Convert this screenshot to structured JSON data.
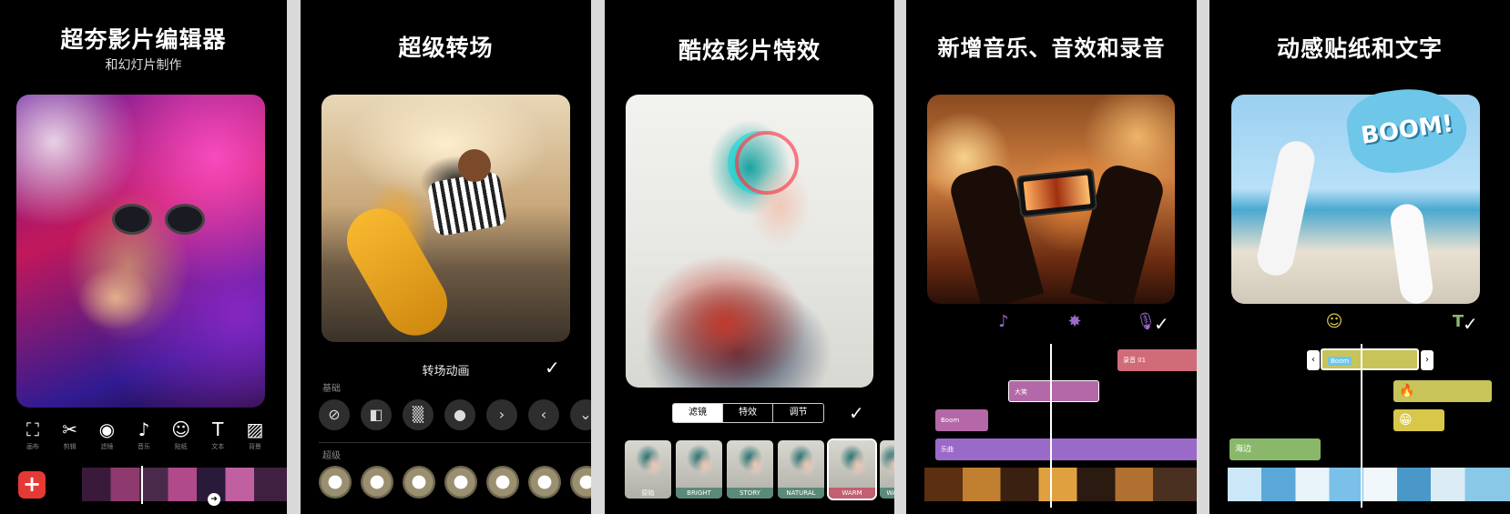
{
  "panels": {
    "p1": {
      "title": "超夯影片编辑器",
      "subtitle": "和幻灯片制作",
      "tools": [
        {
          "icon": "⛶",
          "label": "画布"
        },
        {
          "icon": "✂",
          "label": "剪辑"
        },
        {
          "icon": "◉",
          "label": "滤镜"
        },
        {
          "icon": "♪",
          "label": "音乐"
        },
        {
          "icon": "☺",
          "label": "贴纸"
        },
        {
          "icon": "T",
          "label": "文本"
        },
        {
          "icon": "▨",
          "label": "背景"
        }
      ],
      "add_symbol": "+",
      "knob_symbol": "➜"
    },
    "p2": {
      "title": "超级转场",
      "section_title": "转场动画",
      "group_basic": "基础",
      "group_super": "超级",
      "basic_icons": [
        "⊘",
        "◧",
        "▒",
        "●",
        "›",
        "‹",
        "⌄"
      ],
      "check": "✓"
    },
    "p3": {
      "title": "酷炫影片特效",
      "tabs": [
        "滤镜",
        "特效",
        "调节"
      ],
      "active_tab": "滤镜",
      "check": "✓",
      "filters": [
        "原始",
        "BRIGHT",
        "STORY",
        "NATURAL",
        "WARM",
        "WA"
      ]
    },
    "p4": {
      "title": "新增音乐、音效和录音",
      "icons": [
        "♪",
        "✸",
        "🎙"
      ],
      "check": "✓",
      "clips": {
        "recording": "录音 01",
        "laugh": "大笑",
        "boom": "Boom",
        "music": "乐曲"
      }
    },
    "p5": {
      "title": "动感贴纸和文字",
      "sticker_text": "BOOM!",
      "icons": [
        "☺",
        "T"
      ],
      "check": "✓",
      "mini_sticker": "Boom",
      "emoji_fire": "🔥",
      "emoji_grin": "😁",
      "text_clip": "海边",
      "handle_left": "‹",
      "handle_right": "›"
    }
  },
  "colors": {
    "accent_red": "#e53935",
    "clip_pink": "#d06c78",
    "clip_magenta": "#b468a8",
    "clip_purple": "#9a6ac8",
    "clip_yellow": "#c8c45a",
    "clip_green": "#8ab86a",
    "icon_purple": "#9a6ac8",
    "icon_green": "#8ab86a",
    "icon_yellow": "#d8c84a"
  }
}
